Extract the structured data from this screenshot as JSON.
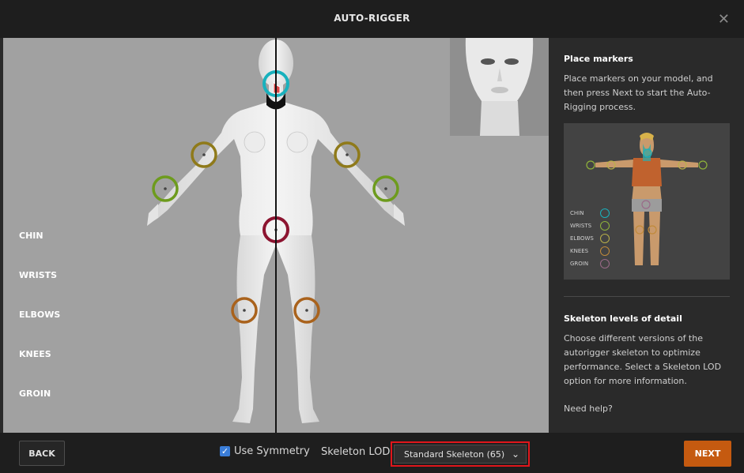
{
  "window": {
    "title": "AUTO-RIGGER",
    "close_label": "✕"
  },
  "viewport": {
    "marker_labels": [
      "CHIN",
      "WRISTS",
      "ELBOWS",
      "KNEES",
      "GROIN"
    ],
    "marker_colors": {
      "chin": "#19b1bd",
      "wrists": "#6d9b1d",
      "elbows": "#8f7a1a",
      "knees": "#a9621c",
      "groin": "#8c1430"
    }
  },
  "panel": {
    "place_title": "Place markers",
    "place_text": "Place markers on your model, and then press Next to start the Auto-Rigging process.",
    "legend": [
      {
        "label": "CHIN",
        "color": "#19b1bd"
      },
      {
        "label": "WRISTS",
        "color": "#8fb33a"
      },
      {
        "label": "ELBOWS",
        "color": "#b9b04a"
      },
      {
        "label": "KNEES",
        "color": "#c08a3a"
      },
      {
        "label": "GROIN",
        "color": "#9a6a88"
      }
    ],
    "lod_title": "Skeleton levels of detail",
    "lod_text": "Choose different versions of the autorigger skeleton to optimize performance. Select a Skeleton LOD option for more information.",
    "help_link": "Need help?"
  },
  "footer": {
    "back_label": "BACK",
    "symmetry_label": "Use Symmetry",
    "symmetry_checked": true,
    "lod_label": "Skeleton LOD",
    "lod_selected": "Standard Skeleton (65)",
    "next_label": "NEXT"
  },
  "colors": {
    "accent": "#c55a10",
    "highlight_border": "#e0161b",
    "checkbox": "#3a7dd8"
  }
}
